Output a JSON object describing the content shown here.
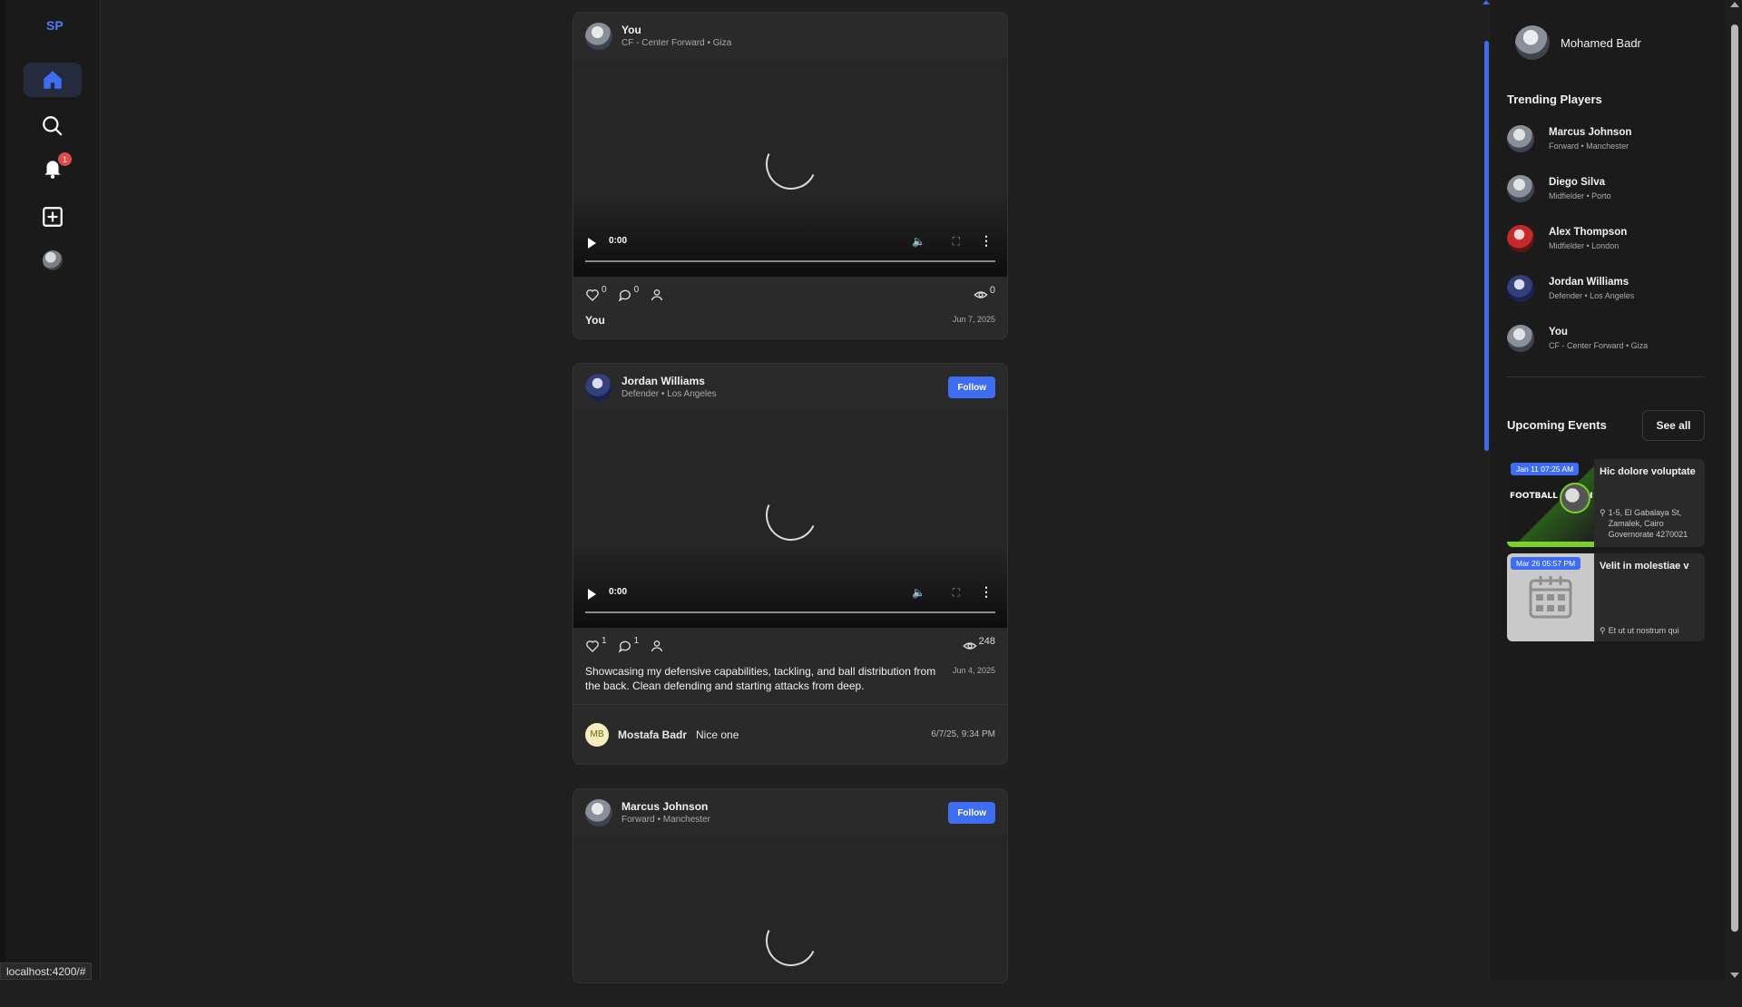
{
  "app": {
    "logo": "SP"
  },
  "nav": {
    "items": [
      "home",
      "search",
      "notifications",
      "create",
      "profile"
    ],
    "notification_count": "1"
  },
  "posts": [
    {
      "author": "You",
      "meta": "CF - Center Forward • Giza",
      "show_follow": false,
      "video_time": "0:00",
      "likes": "0",
      "comments": "0",
      "views": "0",
      "caption": "You",
      "date": "Jun 7, 2025"
    },
    {
      "author": "Jordan Williams",
      "meta": "Defender • Los Angeles",
      "follow_label": "Follow",
      "video_time": "0:00",
      "likes": "1",
      "comments": "1",
      "views": "248",
      "caption": " Showcasing my defensive capabilities, tackling, and ball distribution from the back. Clean defending and starting attacks from deep.",
      "date": "Jun 4, 2025",
      "comment": {
        "initials": "MB",
        "author": "Mostafa Badr",
        "text": "Nice one",
        "time": "6/7/25, 9:34 PM"
      }
    },
    {
      "author": "Marcus Johnson",
      "meta": "Forward • Manchester",
      "follow_label": "Follow"
    }
  ],
  "sidebar_right": {
    "current_user": "Mohamed Badr",
    "trending_title": "Trending Players",
    "trending": [
      {
        "name": "Marcus Johnson",
        "meta": "Forward • Manchester"
      },
      {
        "name": "Diego Silva",
        "meta": "Midfielder • Porto"
      },
      {
        "name": "Alex Thompson",
        "meta": "Midfielder • London"
      },
      {
        "name": "Jordan Williams",
        "meta": "Defender • Los Angeles"
      },
      {
        "name": "You",
        "meta": "CF - Center Forward • Giza"
      }
    ],
    "events_title": "Upcoming Events",
    "see_all": "See all",
    "events": [
      {
        "badge": "Jan 11 07:25 AM",
        "title": "Hic dolore voluptate",
        "location": "1-5, El Gabalaya St, Zamalek, Cairo Governorate 4270021",
        "thumb_text": "FOOTBALL MATCH"
      },
      {
        "badge": "Mar 26 05:57 PM",
        "title": "Velit in molestiae v",
        "location": "Et ut ut nostrum qui"
      }
    ]
  },
  "status_bar": {
    "url": "localhost:4200/#"
  },
  "colors": {
    "accent": "#3f6df2",
    "background": "#1f1f1f",
    "card": "#2a2a2a",
    "badge": "#e24a4a"
  }
}
